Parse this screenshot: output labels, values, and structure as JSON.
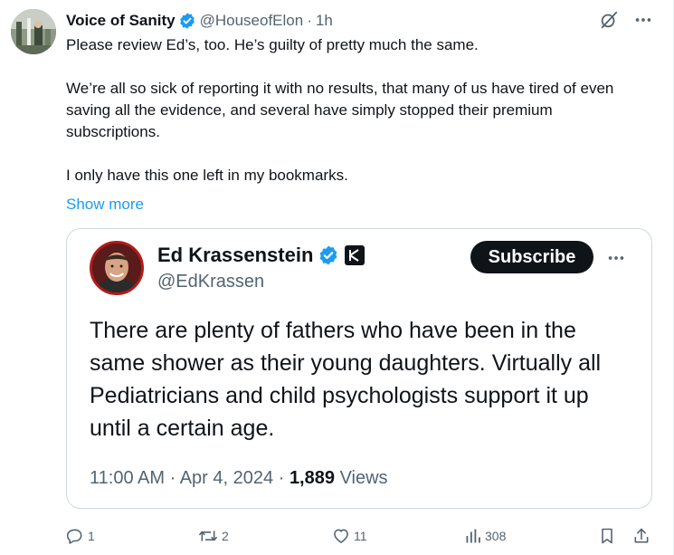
{
  "post": {
    "display_name": "Voice of Sanity",
    "handle": "@HouseofElon",
    "separator": "·",
    "time": "1h",
    "paragraphs": [
      "Please review Ed’s, too. He’s guilty of pretty much the same.",
      "We’re all so sick of reporting it with no results, that many of us have tired of even saving all the evidence, and several have simply stopped their premium subscriptions.",
      "I only have this one left in my bookmarks."
    ],
    "show_more": "Show more"
  },
  "quoted": {
    "display_name": "Ed Krassenstein",
    "handle": "@EdKrassen",
    "subscribe_label": "Subscribe",
    "text_lines": [
      "There are plenty of fathers who have been in the",
      "same shower as their young daughters.  Virtually all",
      "Pediatricians and child psychologists support it up",
      "until a certain age."
    ],
    "time": "11:00 AM",
    "separator1": "·",
    "date": "Apr 4, 2024",
    "separator2": "·",
    "views_count": "1,889",
    "views_label": "Views"
  },
  "actions": {
    "replies": "1",
    "reposts": "2",
    "likes": "11",
    "views": "308"
  },
  "colors": {
    "accent": "#1d9bf0",
    "text": "#0f1419",
    "muted": "#536471",
    "border": "#cfd9de"
  },
  "icons": [
    "verified-badge-icon",
    "grok-icon",
    "more-icon",
    "reply-icon",
    "repost-icon",
    "like-icon",
    "views-icon",
    "bookmark-icon",
    "share-icon"
  ]
}
